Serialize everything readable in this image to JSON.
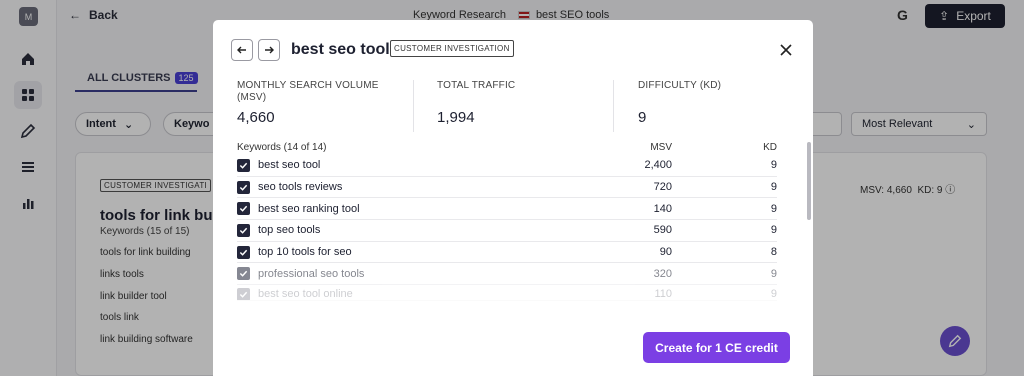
{
  "app": {
    "logo_letter": "M",
    "back_label": "Back",
    "breadcrumb": {
      "section": "Keyword Research",
      "project": "best SEO tools"
    },
    "export_label": "Export",
    "google_icon": "G"
  },
  "tabs": {
    "all_clusters_label": "ALL CLUSTERS",
    "all_clusters_count": "125"
  },
  "filters": {
    "intent_label": "Intent",
    "keywords_label": "Keywo",
    "sort_label": "Most Relevant"
  },
  "background_card": {
    "badge": "CUSTOMER INVESTIGATI",
    "title": "tools for link buil",
    "subtitle": "Keywords (15 of 15)",
    "keywords": [
      "tools for link building",
      "links tools",
      "link builder tool",
      "tools link",
      "link building software"
    ],
    "msv_label": "MSV: 4,660",
    "kd_label": "KD: 9"
  },
  "modal": {
    "title": "best seo tool",
    "badge": "CUSTOMER INVESTIGATION",
    "stats": {
      "msv_label": "MONTHLY SEARCH VOLUME (MSV)",
      "msv_value": "4,660",
      "traffic_label": "TOTAL TRAFFIC",
      "traffic_value": "1,994",
      "difficulty_label": "DIFFICULTY (KD)",
      "difficulty_value": "9"
    },
    "keywords_header": "Keywords (14 of 14)",
    "col_msv": "MSV",
    "col_kd": "KD",
    "rows": [
      {
        "keyword": "best seo tool",
        "msv": "2,400",
        "kd": "9"
      },
      {
        "keyword": "seo tools reviews",
        "msv": "720",
        "kd": "9"
      },
      {
        "keyword": "best seo ranking tool",
        "msv": "140",
        "kd": "9"
      },
      {
        "keyword": "top seo tools",
        "msv": "590",
        "kd": "9"
      },
      {
        "keyword": "top 10 tools for seo",
        "msv": "90",
        "kd": "8"
      },
      {
        "keyword": "professional seo tools",
        "msv": "320",
        "kd": "9"
      },
      {
        "keyword": "best seo tool online",
        "msv": "110",
        "kd": "9"
      }
    ],
    "cta_label": "Create for 1 CE credit"
  },
  "colors": {
    "accent": "#7b3fe4",
    "dark": "#1e2030",
    "checkbox": "#23263a"
  }
}
